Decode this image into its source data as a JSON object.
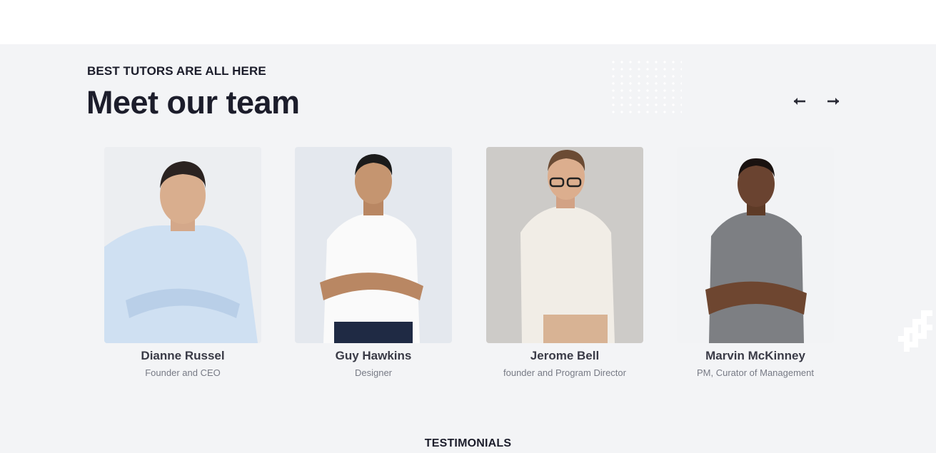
{
  "team": {
    "eyebrow": "BEST TUTORS ARE ALL HERE",
    "title": "Meet our team",
    "nav": {
      "prev_icon": "arrow-left-icon",
      "next_icon": "arrow-right-icon"
    },
    "members": [
      {
        "name": "Dianne Russel",
        "role": "Founder and CEO"
      },
      {
        "name": "Guy Hawkins",
        "role": "Designer"
      },
      {
        "name": "Jerome Bell",
        "role": "founder and Program Director"
      },
      {
        "name": "Marvin McKinney",
        "role": "PM, Curator of Management"
      }
    ]
  },
  "testimonials": {
    "label": "TESTIMONIALS"
  },
  "colors": {
    "section_bg": "#f3f4f6",
    "heading": "#1c1d2b",
    "name": "#3a3b47",
    "role": "#777a85"
  }
}
